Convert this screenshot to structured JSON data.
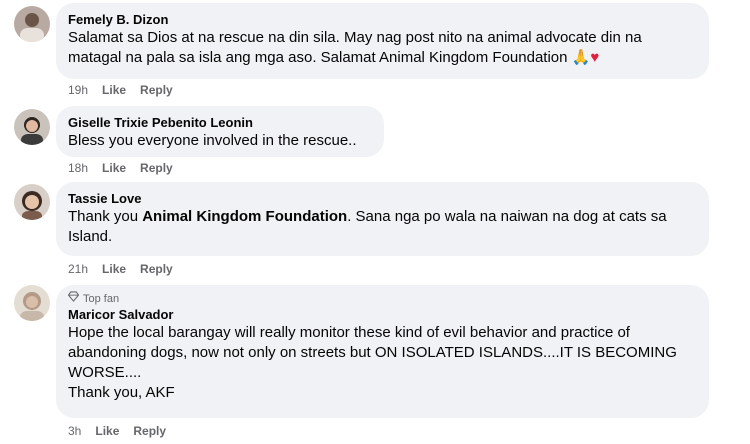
{
  "comments": [
    {
      "author": "Femely B. Dizon",
      "text": "Salamat sa Dios at na rescue na din sila. May nag post nito na animal advocate din na matagal na pala sa isla ang mga aso. Salamat Animal Kingdom Foundation",
      "emoji_pray": "🙏",
      "emoji_heart": "♥",
      "time": "19h",
      "like": "Like",
      "reply": "Reply"
    },
    {
      "author": "Giselle Trixie Pebenito Leonin",
      "text": "Bless you everyone involved in the rescue..",
      "time": "18h",
      "like": "Like",
      "reply": "Reply"
    },
    {
      "author": "Tassie Love",
      "text_before": "Thank you ",
      "text_bold": "Animal Kingdom Foundation",
      "text_after": ". Sana nga po wala na naiwan na dog at cats sa Island.",
      "time": "21h",
      "like": "Like",
      "reply": "Reply"
    },
    {
      "badge": "Top fan",
      "author": "Maricor Salvador",
      "text_line1": "Hope the local barangay will really monitor these kind of evil behavior and practice of abandoning dogs, now not only on streets but ON ISOLATED ISLANDS....IT IS BECOMING WORSE....",
      "text_line2": "Thank you, AKF",
      "time": "3h",
      "like": "Like",
      "reply": "Reply"
    }
  ],
  "colors": {
    "bubble": "#f0f2f5",
    "meta": "#65676b",
    "heart": "#e41e3f"
  }
}
